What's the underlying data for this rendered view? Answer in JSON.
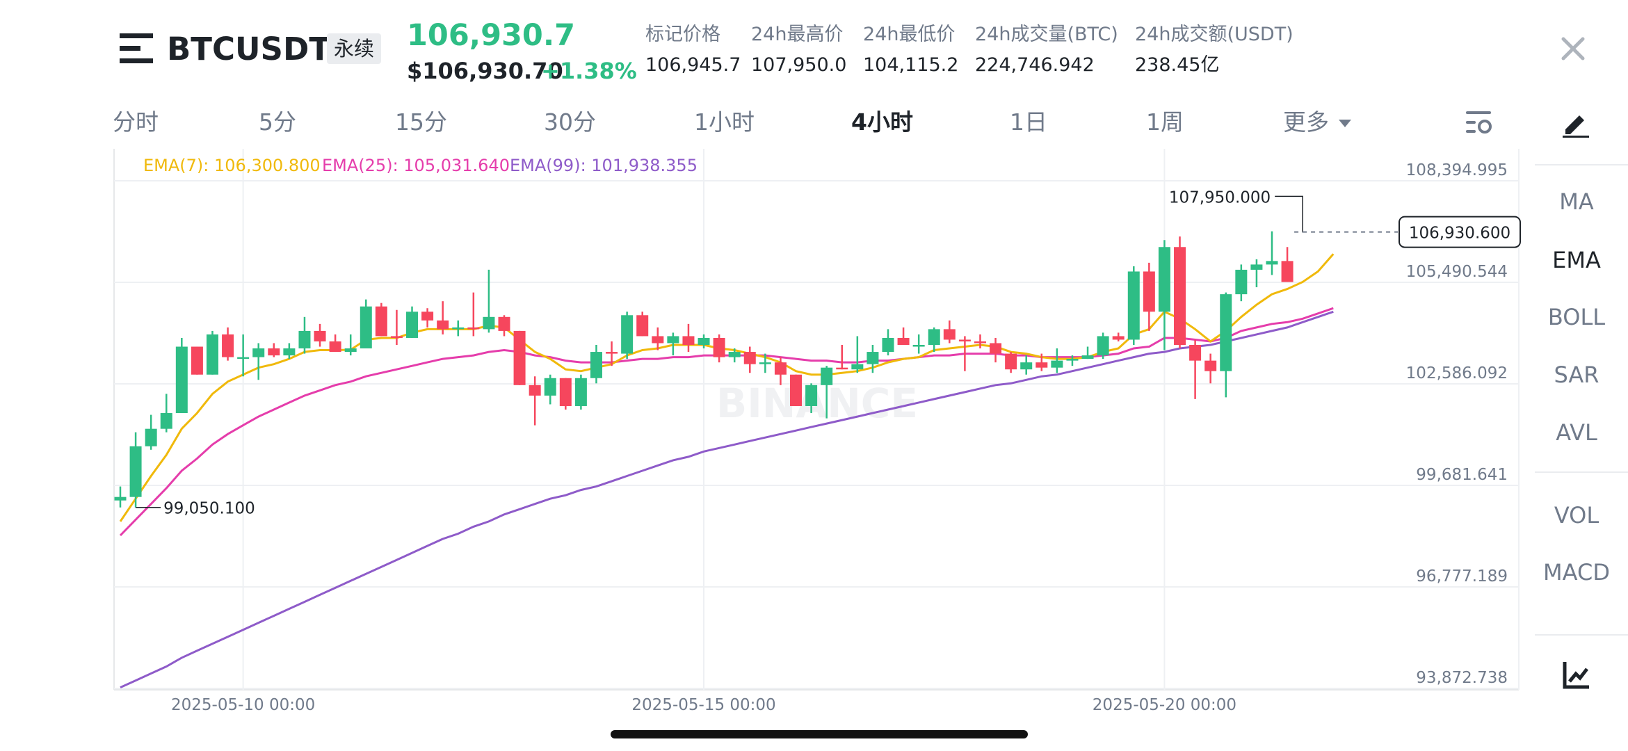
{
  "header": {
    "symbol": "BTCUSDT",
    "contract_type": "永续",
    "last_price": "106,930.7",
    "usd_price": "$106,930.70",
    "change_pct": "+1.38%",
    "stats": [
      {
        "label": "标记价格",
        "value": "106,945.7"
      },
      {
        "label": "24h最高价",
        "value": "107,950.0"
      },
      {
        "label": "24h最低价",
        "value": "104,115.2"
      },
      {
        "label": "24h成交量(BTC)",
        "value": "224,746.942"
      },
      {
        "label": "24h成交额(USDT)",
        "value": "238.45亿"
      }
    ],
    "icons": {
      "menu": "menu-icon",
      "close": "close-icon"
    }
  },
  "intervals": {
    "tabs": [
      "分时",
      "5分",
      "15分",
      "30分",
      "1小时",
      "4小时",
      "1日",
      "1周"
    ],
    "active": "4小时",
    "more_label": "更多",
    "settings_icon": "chart-settings-icon"
  },
  "side_panel": {
    "draw_icon": "pencil-icon",
    "main_indicators": [
      "MA",
      "EMA",
      "BOLL",
      "SAR",
      "AVL"
    ],
    "active_indicator": "EMA",
    "sub_indicators": [
      "VOL",
      "MACD"
    ],
    "chart_type_icon": "line-chart-icon"
  },
  "colors": {
    "up": "#2ebd85",
    "down": "#f6465d",
    "ema7": "#f0b90b",
    "ema25": "#e53dab",
    "ema99": "#8e5bc9",
    "text_primary": "#1e2329",
    "text_secondary": "#707a8a",
    "grid": "#eef0f3"
  },
  "watermark": "BINANCE",
  "chart_data": {
    "type": "candlestick",
    "interval": "4小时",
    "legend": [
      {
        "name": "EMA(7)",
        "value": "106,300.800",
        "color": "#f0b90b"
      },
      {
        "name": "EMA(25)",
        "value": "105,031.640",
        "color": "#e53dab"
      },
      {
        "name": "EMA(99)",
        "value": "101,938.355",
        "color": "#8e5bc9"
      }
    ],
    "y_ticks": [
      "108,394.995",
      "105,490.544",
      "102,586.092",
      "99,681.641",
      "96,777.189",
      "93,872.738"
    ],
    "ylim": [
      93872.738,
      108394.995
    ],
    "x_ticks": [
      {
        "label": "2025-05-10 00:00",
        "index": 8
      },
      {
        "label": "2025-05-15 00:00",
        "index": 38
      },
      {
        "label": "2025-05-20 00:00",
        "index": 68
      }
    ],
    "max_marker": {
      "label": "107,950.000",
      "value": 107950.0,
      "index": 77
    },
    "min_marker": {
      "label": "99,050.100",
      "value": 99050.1,
      "index": 1
    },
    "current_price": {
      "label": "106,930.600",
      "value": 106930.6
    },
    "candles": [
      {
        "o": 99250,
        "h": 99650,
        "l": 99050,
        "c": 99350
      },
      {
        "o": 99350,
        "h": 101200,
        "l": 99050,
        "c": 100800
      },
      {
        "o": 100800,
        "h": 101700,
        "l": 100700,
        "c": 101300
      },
      {
        "o": 101300,
        "h": 102300,
        "l": 101200,
        "c": 101750
      },
      {
        "o": 101750,
        "h": 103900,
        "l": 101750,
        "c": 103650
      },
      {
        "o": 103650,
        "h": 103650,
        "l": 102850,
        "c": 102850
      },
      {
        "o": 102850,
        "h": 104100,
        "l": 102850,
        "c": 104000
      },
      {
        "o": 104000,
        "h": 104200,
        "l": 103250,
        "c": 103350
      },
      {
        "o": 103350,
        "h": 104000,
        "l": 102800,
        "c": 103350
      },
      {
        "o": 103350,
        "h": 103750,
        "l": 102700,
        "c": 103600
      },
      {
        "o": 103600,
        "h": 103750,
        "l": 103350,
        "c": 103400
      },
      {
        "o": 103400,
        "h": 103750,
        "l": 103300,
        "c": 103600
      },
      {
        "o": 103600,
        "h": 104500,
        "l": 103450,
        "c": 104100
      },
      {
        "o": 104100,
        "h": 104300,
        "l": 103650,
        "c": 103800
      },
      {
        "o": 103800,
        "h": 104000,
        "l": 103500,
        "c": 103500
      },
      {
        "o": 103500,
        "h": 104000,
        "l": 103400,
        "c": 103600
      },
      {
        "o": 103600,
        "h": 105000,
        "l": 103600,
        "c": 104800
      },
      {
        "o": 104800,
        "h": 104900,
        "l": 103950,
        "c": 103950
      },
      {
        "o": 103950,
        "h": 104700,
        "l": 103700,
        "c": 103900
      },
      {
        "o": 103900,
        "h": 104800,
        "l": 103900,
        "c": 104650
      },
      {
        "o": 104650,
        "h": 104750,
        "l": 104200,
        "c": 104400
      },
      {
        "o": 104400,
        "h": 104950,
        "l": 104000,
        "c": 104150
      },
      {
        "o": 104150,
        "h": 104400,
        "l": 103950,
        "c": 104200
      },
      {
        "o": 104200,
        "h": 105200,
        "l": 103950,
        "c": 104150
      },
      {
        "o": 104150,
        "h": 105850,
        "l": 104050,
        "c": 104500
      },
      {
        "o": 104500,
        "h": 104550,
        "l": 103950,
        "c": 104100
      },
      {
        "o": 104100,
        "h": 104100,
        "l": 102550,
        "c": 102550
      },
      {
        "o": 102550,
        "h": 102800,
        "l": 101400,
        "c": 102250
      },
      {
        "o": 102250,
        "h": 102850,
        "l": 102000,
        "c": 102750
      },
      {
        "o": 102750,
        "h": 102750,
        "l": 101850,
        "c": 101950
      },
      {
        "o": 101950,
        "h": 102850,
        "l": 101850,
        "c": 102750
      },
      {
        "o": 102750,
        "h": 103700,
        "l": 102600,
        "c": 103500
      },
      {
        "o": 103500,
        "h": 103800,
        "l": 103100,
        "c": 103450
      },
      {
        "o": 103450,
        "h": 104650,
        "l": 103300,
        "c": 104550
      },
      {
        "o": 104550,
        "h": 104650,
        "l": 103950,
        "c": 103950
      },
      {
        "o": 103950,
        "h": 104200,
        "l": 103550,
        "c": 103750
      },
      {
        "o": 103750,
        "h": 104050,
        "l": 103400,
        "c": 103950
      },
      {
        "o": 103950,
        "h": 104300,
        "l": 103500,
        "c": 103700
      },
      {
        "o": 103700,
        "h": 104000,
        "l": 103600,
        "c": 103900
      },
      {
        "o": 103900,
        "h": 104000,
        "l": 103200,
        "c": 103350
      },
      {
        "o": 103350,
        "h": 103600,
        "l": 103200,
        "c": 103500
      },
      {
        "o": 103500,
        "h": 103650,
        "l": 102900,
        "c": 103150
      },
      {
        "o": 103150,
        "h": 103450,
        "l": 102900,
        "c": 103200
      },
      {
        "o": 103200,
        "h": 103350,
        "l": 102550,
        "c": 102850
      },
      {
        "o": 102850,
        "h": 102850,
        "l": 101950,
        "c": 101950
      },
      {
        "o": 101950,
        "h": 102600,
        "l": 101750,
        "c": 102550
      },
      {
        "o": 102550,
        "h": 103100,
        "l": 101600,
        "c": 103050
      },
      {
        "o": 103050,
        "h": 103700,
        "l": 103000,
        "c": 103000
      },
      {
        "o": 103000,
        "h": 103950,
        "l": 102900,
        "c": 103150
      },
      {
        "o": 103150,
        "h": 103700,
        "l": 102900,
        "c": 103500
      },
      {
        "o": 103500,
        "h": 104150,
        "l": 103400,
        "c": 103900
      },
      {
        "o": 103900,
        "h": 104200,
        "l": 103700,
        "c": 103700
      },
      {
        "o": 103700,
        "h": 104000,
        "l": 103450,
        "c": 103700
      },
      {
        "o": 103700,
        "h": 104200,
        "l": 103500,
        "c": 104150
      },
      {
        "o": 104150,
        "h": 104400,
        "l": 103750,
        "c": 103850
      },
      {
        "o": 103850,
        "h": 103950,
        "l": 102950,
        "c": 103800
      },
      {
        "o": 103800,
        "h": 104000,
        "l": 103600,
        "c": 103750
      },
      {
        "o": 103750,
        "h": 103900,
        "l": 103200,
        "c": 103450
      },
      {
        "o": 103450,
        "h": 103500,
        "l": 102900,
        "c": 103000
      },
      {
        "o": 103000,
        "h": 103400,
        "l": 102850,
        "c": 103200
      },
      {
        "o": 103200,
        "h": 103450,
        "l": 102950,
        "c": 103050
      },
      {
        "o": 103050,
        "h": 103600,
        "l": 102900,
        "c": 103250
      },
      {
        "o": 103250,
        "h": 103400,
        "l": 103100,
        "c": 103300
      },
      {
        "o": 103300,
        "h": 103650,
        "l": 103300,
        "c": 103400
      },
      {
        "o": 103400,
        "h": 104050,
        "l": 103300,
        "c": 103950
      },
      {
        "o": 103950,
        "h": 104050,
        "l": 103800,
        "c": 103850
      },
      {
        "o": 103850,
        "h": 105950,
        "l": 103700,
        "c": 105800
      },
      {
        "o": 105800,
        "h": 106050,
        "l": 104100,
        "c": 104650
      },
      {
        "o": 104650,
        "h": 106700,
        "l": 103550,
        "c": 106500
      },
      {
        "o": 106500,
        "h": 106800,
        "l": 103600,
        "c": 103700
      },
      {
        "o": 103700,
        "h": 103850,
        "l": 102150,
        "c": 103250
      },
      {
        "o": 103250,
        "h": 103450,
        "l": 102600,
        "c": 102950
      },
      {
        "o": 102950,
        "h": 105200,
        "l": 102200,
        "c": 105150
      },
      {
        "o": 105150,
        "h": 106000,
        "l": 104950,
        "c": 105850
      },
      {
        "o": 105850,
        "h": 106150,
        "l": 105350,
        "c": 106000
      },
      {
        "o": 106000,
        "h": 106950,
        "l": 105700,
        "c": 106100
      },
      {
        "o": 106100,
        "h": 106500,
        "l": 105500,
        "c": 105500
      }
    ],
    "ema7": [
      98650,
      99300,
      99950,
      100550,
      101300,
      101750,
      102300,
      102650,
      102850,
      103050,
      103150,
      103300,
      103500,
      103550,
      103550,
      103560,
      103850,
      103900,
      103900,
      104050,
      104150,
      104150,
      104150,
      104150,
      104250,
      104200,
      103850,
      103500,
      103300,
      103000,
      102950,
      103050,
      103150,
      103400,
      103550,
      103600,
      103700,
      103700,
      103700,
      103600,
      103550,
      103450,
      103350,
      103200,
      102950,
      102850,
      102850,
      102900,
      102950,
      103050,
      103200,
      103300,
      103350,
      103550,
      103600,
      103650,
      103700,
      103650,
      103500,
      103450,
      103350,
      103300,
      103300,
      103350,
      103500,
      103600,
      104000,
      104150,
      104650,
      104450,
      104150,
      103800,
      104100,
      104500,
      104850,
      105150,
      105300,
      105500,
      105800,
      106300
    ],
    "ema25": [
      98250,
      98700,
      99150,
      99600,
      100100,
      100450,
      100850,
      101150,
      101400,
      101650,
      101850,
      102050,
      102250,
      102400,
      102550,
      102650,
      102800,
      102900,
      103000,
      103100,
      103200,
      103300,
      103350,
      103400,
      103500,
      103550,
      103500,
      103400,
      103350,
      103250,
      103200,
      103200,
      103200,
      103250,
      103300,
      103300,
      103350,
      103350,
      103400,
      103400,
      103400,
      103400,
      103400,
      103350,
      103300,
      103250,
      103250,
      103200,
      103200,
      103250,
      103250,
      103300,
      103350,
      103400,
      103400,
      103450,
      103450,
      103450,
      103400,
      103400,
      103350,
      103350,
      103350,
      103350,
      103400,
      103450,
      103600,
      103650,
      103900,
      103900,
      103850,
      103800,
      103900,
      104100,
      104200,
      104300,
      104350,
      104450,
      104600,
      104750
    ],
    "ema99": [
      93900,
      94100,
      94300,
      94500,
      94750,
      94950,
      95150,
      95350,
      95550,
      95750,
      95950,
      96150,
      96350,
      96550,
      96750,
      96950,
      97150,
      97350,
      97550,
      97750,
      97950,
      98150,
      98300,
      98500,
      98650,
      98850,
      99000,
      99150,
      99300,
      99400,
      99550,
      99650,
      99800,
      99950,
      100100,
      100250,
      100400,
      100500,
      100650,
      100750,
      100850,
      100950,
      101050,
      101150,
      101250,
      101350,
      101450,
      101550,
      101650,
      101750,
      101850,
      101950,
      102050,
      102150,
      102250,
      102350,
      102450,
      102550,
      102600,
      102700,
      102800,
      102850,
      102950,
      103050,
      103150,
      103250,
      103350,
      103450,
      103500,
      103600,
      103650,
      103700,
      103800,
      103900,
      104000,
      104100,
      104200,
      104350,
      104500,
      104650
    ]
  }
}
